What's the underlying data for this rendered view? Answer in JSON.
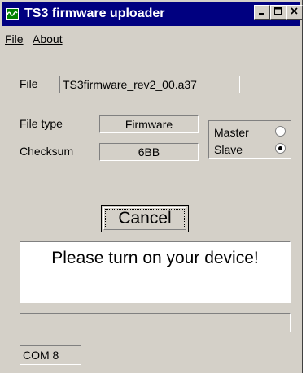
{
  "window": {
    "title": "TS3 firmware uploader",
    "icon": "waveform-app-icon",
    "controls": [
      "minimize-icon",
      "maximize-icon",
      "close-icon"
    ]
  },
  "menu": {
    "file_label": "File",
    "about_label": "About"
  },
  "form": {
    "file_label": "File",
    "file_value": "TS3firmware_rev2_00.a37",
    "file_type_label": "File type",
    "file_type_value": "Firmware",
    "checksum_label": "Checksum",
    "checksum_value": "6BB"
  },
  "mode": {
    "master_label": "Master",
    "slave_label": "Slave",
    "selected": "Slave"
  },
  "actions": {
    "cancel_label": "Cancel"
  },
  "message": {
    "text": "Please turn on your device!"
  },
  "progress": {
    "value": 0
  },
  "status": {
    "port": "COM 8"
  },
  "colors": {
    "face": "#d4d0c8",
    "titlebar": "#000080"
  }
}
